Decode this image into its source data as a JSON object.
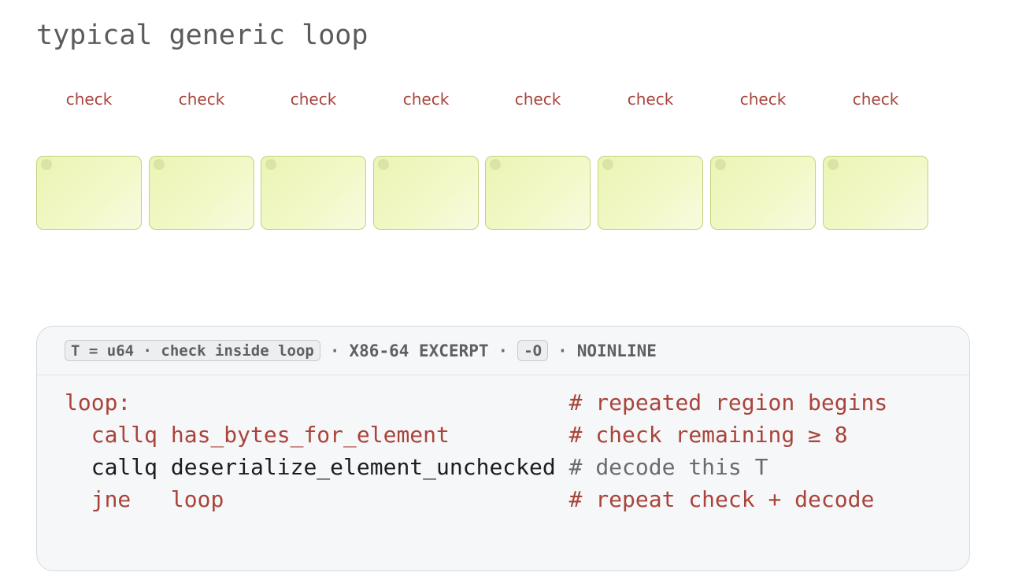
{
  "title": "typical generic loop",
  "cells": [
    {
      "label": "check"
    },
    {
      "label": "check"
    },
    {
      "label": "check"
    },
    {
      "label": "check"
    },
    {
      "label": "check"
    },
    {
      "label": "check"
    },
    {
      "label": "check"
    },
    {
      "label": "check"
    }
  ],
  "panel": {
    "tag": "T = u64 · check inside loop",
    "separator": "·",
    "arch": "X86-64 EXCERPT",
    "opt_flag": "-O",
    "attr": "NOINLINE"
  },
  "code": [
    {
      "indent": "",
      "op": "loop:",
      "pad": "",
      "arg": "",
      "gap": "                                 ",
      "comment": "# repeated region begins",
      "style": "red"
    },
    {
      "indent": "  ",
      "op": "callq",
      "pad": " ",
      "arg": "has_bytes_for_element",
      "gap": "         ",
      "comment": "# check remaining ≥ 8",
      "style": "red"
    },
    {
      "indent": "  ",
      "op": "callq",
      "pad": " ",
      "arg": "deserialize_element_unchecked",
      "gap": " ",
      "comment": "# decode this T",
      "style": "black"
    },
    {
      "indent": "  ",
      "op": "jne",
      "pad": "   ",
      "arg": "loop",
      "gap": "                          ",
      "comment": "# repeat check + decode",
      "style": "red"
    }
  ],
  "colors": {
    "accent_red": "#a9443b",
    "cell_fill": "#f0f7c0",
    "cell_border": "#c3d27e",
    "panel_bg": "#f6f7f9",
    "title_gray": "#5b5b5b"
  }
}
